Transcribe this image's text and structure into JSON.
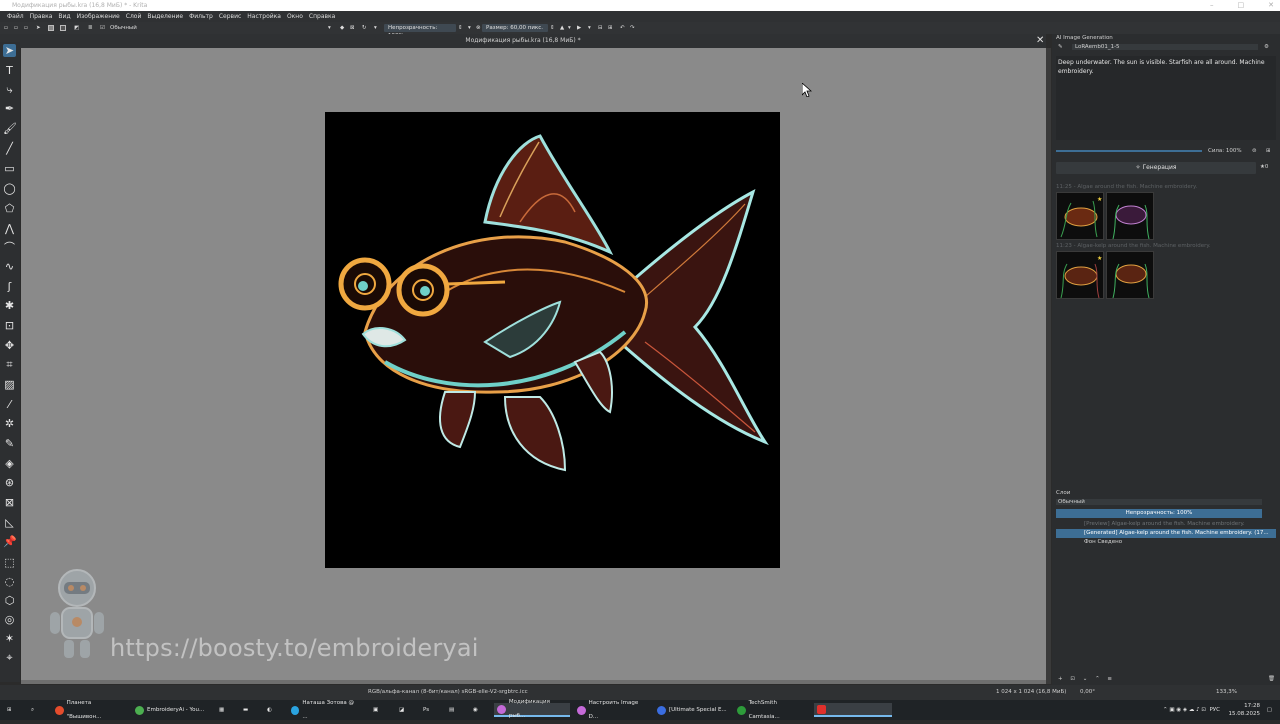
{
  "window": {
    "title": "Модификация рыбы.kra (16,8 МиБ) * - Krita"
  },
  "menu": [
    "Файл",
    "Правка",
    "Вид",
    "Изображение",
    "Слой",
    "Выделение",
    "Фильтр",
    "Сервис",
    "Настройка",
    "Окно",
    "Справка"
  ],
  "toolbar": {
    "blend_mode": "Обычный",
    "opacity_label": "Непрозрачность: 100%",
    "size_label": "Размер: 60,00 пикс."
  },
  "document": {
    "tab_title": "Модификация рыбы.kra (16,8 МиБ) *"
  },
  "ai_panel": {
    "title": "AI Image Generation",
    "model": "LoRAemb01_1-5",
    "prompt": "Deep underwater. The sun is visible. Starfish are all around. Machine embroidery.",
    "strength_label": "Сила: 100%",
    "generate_label": "Генерация",
    "history": [
      {
        "label": "11:25 - Algae around the fish. Machine embroidery."
      },
      {
        "label": "11:23 - Algae-kelp around the fish. Machine embroidery."
      }
    ]
  },
  "layers_panel": {
    "title": "Слои",
    "blend_mode": "Обычный",
    "opacity_label": "Непрозрачность: 100%",
    "layers": [
      {
        "name": "[Preview] Algae-kelp around the fish. Machine embroidery."
      },
      {
        "name": "[Generated] Algae-kelp around the fish. Machine embroidery. (17..."
      },
      {
        "name": "Фон Сведено"
      }
    ]
  },
  "statusbar": {
    "color_info": "RGB/альфа-канал (8-бит/канал)  sRGB-elle-V2-srgbtrc.icc",
    "dimensions": "1 024 x 1 024 (16,8 МиБ)",
    "rotation": "0,00°",
    "zoom": "133,3%"
  },
  "watermark": {
    "text": "https://boosty.to/embroideryai"
  },
  "taskbar": {
    "apps": [
      {
        "label": "Планета \"Вышивон...",
        "color": "#e44c2c"
      },
      {
        "label": "EmbroideryAi - You...",
        "color": "#4caf50"
      },
      {
        "label": "Наташа Зотова @ ...",
        "color": "#2aa3e0"
      },
      {
        "label": "Модификация рыб...",
        "color": "#c46ad8"
      },
      {
        "label": "Настроить Image D...",
        "color": "#c46ad8"
      },
      {
        "label": "[Ultimate Special E...",
        "color": "#3a6de0"
      },
      {
        "label": "TechSmith Camtasia...",
        "color": "#2d9b3a"
      }
    ],
    "lang": "РУС",
    "time": "17:28",
    "date": "15.08.2025"
  }
}
